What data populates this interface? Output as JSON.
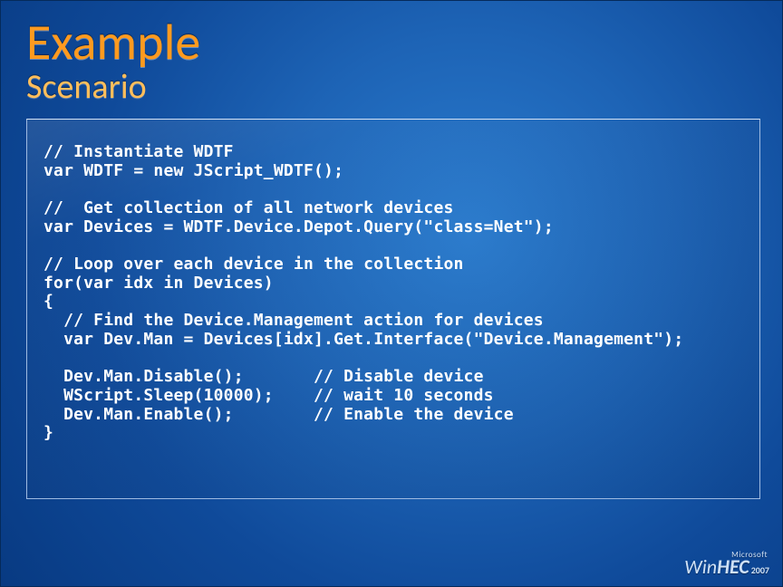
{
  "header": {
    "title": "Example",
    "subtitle": "Scenario"
  },
  "code": {
    "l1": "// Instantiate WDTF",
    "l2": "var WDTF = new JScript_WDTF();",
    "l3": "",
    "l4": "//  Get collection of all network devices",
    "l5": "var Devices = WDTF.Device.Depot.Query(\"class=Net\");",
    "l6": "",
    "l7": "// Loop over each device in the collection",
    "l8": "for(var idx in Devices)",
    "l9": "{",
    "l10": "  // Find the Device.Management action for devices",
    "l11": "  var Dev.Man = Devices[idx].Get.Interface(\"Device.Management\");",
    "l12": "",
    "l13": "  Dev.Man.Disable();       // Disable device",
    "l14": "  WScript.Sleep(10000);    // wait 10 seconds",
    "l15": "  Dev.Man.Enable();        // Enable the device",
    "l16": "}"
  },
  "watermark": {
    "vendor": "Microsoft",
    "brand_a": "Win",
    "brand_b": "HEC",
    "year": "2007"
  }
}
